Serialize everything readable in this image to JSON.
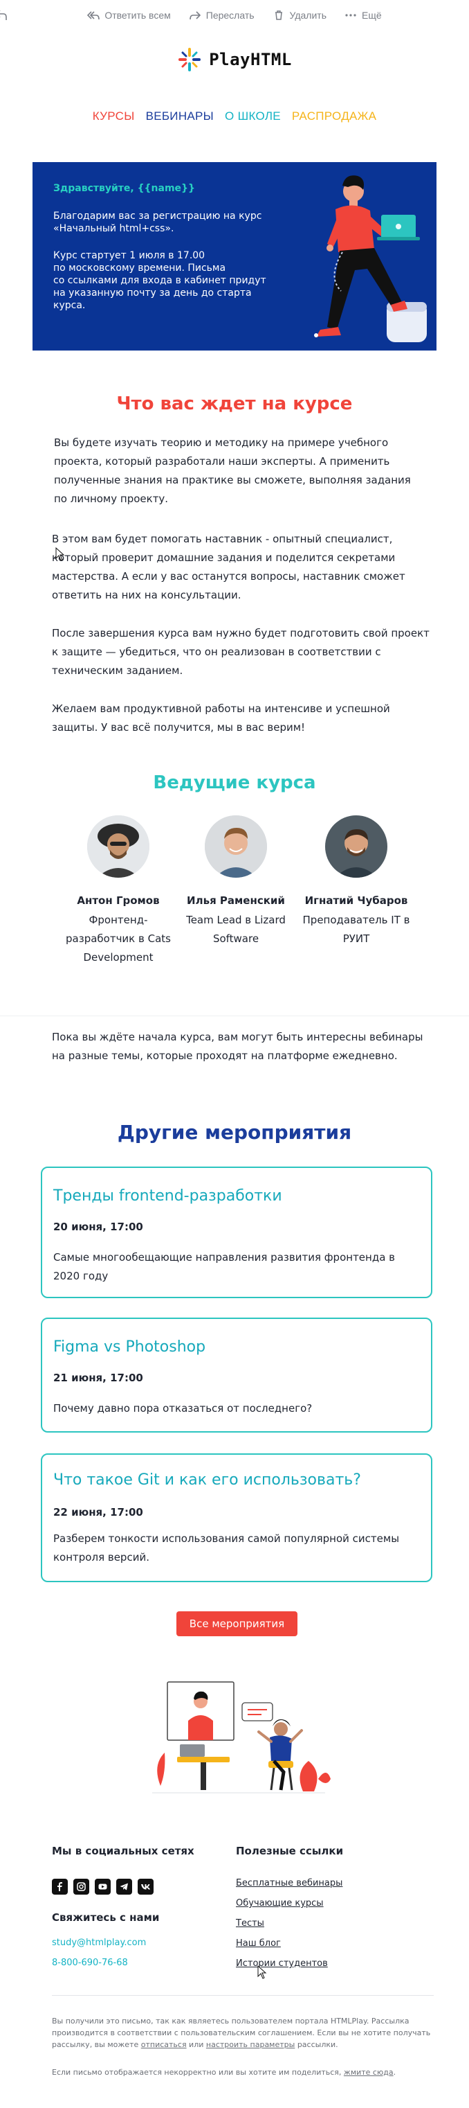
{
  "toolbar": {
    "reply_all": "Ответить всем",
    "forward": "Переслать",
    "delete": "Удалить",
    "more": "Ещё"
  },
  "logo": {
    "text": "PlayHTML"
  },
  "nav": {
    "courses": "КУРСЫ",
    "webinars": "ВЕБИНАРЫ",
    "about": "О ШКОЛЕ",
    "sale": "РАСПРОДАЖА"
  },
  "colors": {
    "courses": "#f0443a",
    "webinars": "#1b3d9c",
    "about": "#14b3c4",
    "sale": "#f5b41a",
    "hero_bg": "#0a3495",
    "accent_red": "#f0443a",
    "accent_teal": "#2cc5c0",
    "heading_blue": "#1b3d9c"
  },
  "hero": {
    "hello": "Здравствуйте, {{name}}",
    "p1": "Благодарим вас за регистрацию на курс\n«Начальный html+css».",
    "p2": "Курс стартует 1 июля в 17.00\nпо московскому времени. Письма\nсо ссылками для входа в кабинет придут\nна указанную почту за день до старта\nкурса."
  },
  "course": {
    "heading": "Что вас ждет на курсе",
    "p1": "Вы будете изучать теорию и методику на примере учебного проекта, который разработали наши эксперты. А применить полученные знания на практике вы сможете, выполняя задания по личному проекту.",
    "p2": "В этом вам будет помогать наставник - опытный специалист, который проверит домашние задания и поделится секретами мастерства. А если у вас останутся вопросы, наставник сможет ответить на них на консультации.",
    "p3": "После завершения курса вам нужно будет подготовить свой проект к защите — убедиться, что он реализован в соответствии с техническим заданием.",
    "p4": "Желаем вам продуктивной работы на интенсиве и успешной защиты. У вас всё получится, мы в вас верим!"
  },
  "teachers": {
    "heading": "Ведущие курса",
    "items": [
      {
        "name": "Антон Громов",
        "role": "Фронтенд-разработчик в Cats Development"
      },
      {
        "name": "Илья Раменский",
        "role": "Team Lead в Lizard Software"
      },
      {
        "name": "Игнатий Чубаров",
        "role": "Преподаватель IT в РУИТ"
      }
    ]
  },
  "events": {
    "intro": "Пока вы ждёте начала курса, вам могут быть интересны вебинары на разные темы, которые проходят на платформе ежедневно.",
    "heading": "Другие мероприятия",
    "items": [
      {
        "title": "Тренды frontend-разработки",
        "date": "20 июня, 17:00",
        "desc": "Самые многообещающие направления развития фронтенда в 2020 году"
      },
      {
        "title": "Figma vs Photoshop",
        "date": "21 июня, 17:00",
        "desc": "Почему давно пора отказаться от последнего?"
      },
      {
        "title": "Что такое Git и как его использовать?",
        "date": "22 июня, 17:00",
        "desc": "Разберем тонкости использования самой популярной системы контроля версий."
      }
    ],
    "button": "Все мероприятия"
  },
  "footer": {
    "social_heading": "Мы в социальных сетях",
    "contact_heading": "Свяжитесь с нами",
    "email": "study@htmlplay.com",
    "phone": "8-800-690-76-68",
    "links_heading": "Полезные ссылки",
    "links": [
      "Бесплатные вебинары",
      "Обучающие курсы",
      "Тесты",
      "Наш блог",
      "Истории студентов"
    ],
    "socials": [
      "facebook-icon",
      "instagram-icon",
      "youtube-icon",
      "telegram-icon",
      "vk-icon"
    ],
    "legal_1a": "Вы получили это письмо, так как являетесь пользователем портала HTMLPlay. Рассылка производится в соответствии с пользовательским соглашением. Если вы не хотите получать рассылку, вы можете ",
    "unsubscribe": "отписаться",
    "legal_1b": " или ",
    "settings": "настроить параметры",
    "legal_1c": " рассылки.",
    "legal_2a": "Если письмо отображается некорректно или вы хотите им поделиться, ",
    "view_online": "жмите сюда",
    "legal_2b": "."
  }
}
